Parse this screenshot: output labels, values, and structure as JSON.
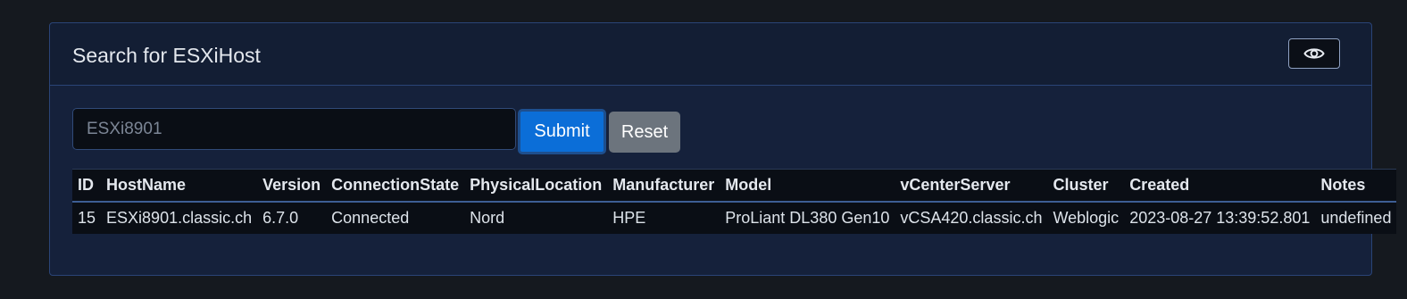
{
  "card": {
    "title": "Search for ESXiHost",
    "toggle_icon": "eye-icon"
  },
  "search": {
    "value": "",
    "placeholder": "ESXi8901"
  },
  "buttons": {
    "submit_label": "Submit",
    "reset_label": "Reset"
  },
  "table": {
    "headers": [
      "ID",
      "HostName",
      "Version",
      "ConnectionState",
      "PhysicalLocation",
      "Manufacturer",
      "Model",
      "vCenterServer",
      "Cluster",
      "Created",
      "Notes"
    ],
    "rows": [
      {
        "id": "15",
        "hostname": "ESXi8901.classic.ch",
        "version": "6.7.0",
        "connection_state": "Connected",
        "physical_location": "Nord",
        "manufacturer": "HPE",
        "model": "ProLiant DL380 Gen10",
        "vcenter_server": "vCSA420.classic.ch",
        "cluster": "Weblogic",
        "created": "2023-08-27 13:39:52.801",
        "notes": "undefined"
      }
    ]
  },
  "colors": {
    "page_background": "#15191f",
    "card_background": "#15213b",
    "card_border": "#2a4477",
    "submit_button": "#0b6ed8",
    "reset_button": "#6c747d",
    "table_background": "#0a0e15"
  }
}
